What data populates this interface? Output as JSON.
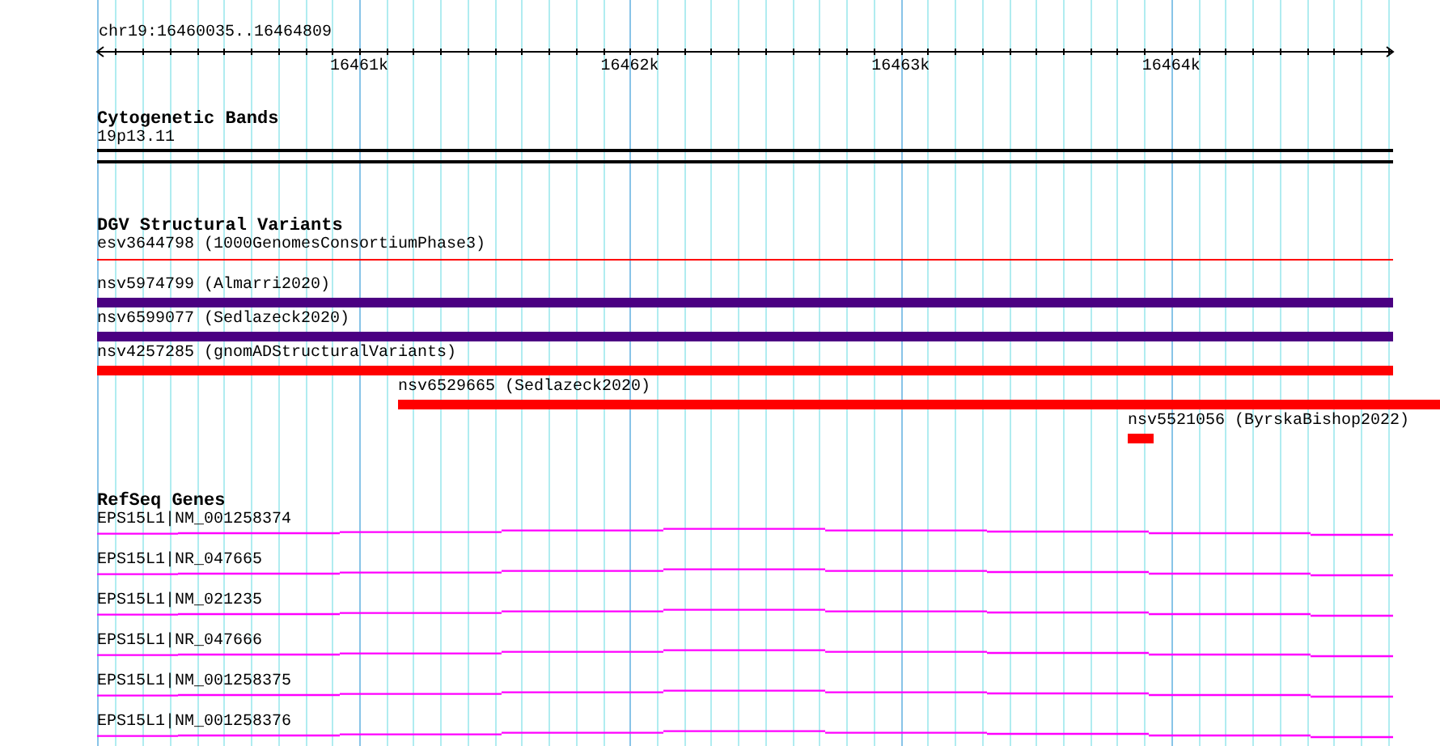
{
  "ruler": {
    "range": "chr19:16460035..16464809",
    "ticks": [
      "16461k",
      "16462k",
      "16463k",
      "16464k"
    ]
  },
  "tracks": [
    {
      "kind": "band",
      "title": "Cytogenetic Bands",
      "features": [
        {
          "label": "19p13.11"
        }
      ]
    },
    {
      "kind": "variants",
      "title": "DGV Structural Variants",
      "features": [
        {
          "label": "esv3644798 (1000GenomesConsortiumPhase3)",
          "kind": "line",
          "color": "#ff0000"
        },
        {
          "label": "nsv5974799 (Almarri2020)",
          "kind": "full",
          "color": "#4b0082"
        },
        {
          "label": "nsv6599077 (Sedlazeck2020)",
          "kind": "full",
          "color": "#4b0082"
        },
        {
          "label": "nsv4257285 (gnomADStructuralVariants)",
          "kind": "full",
          "color": "#ff0000"
        },
        {
          "label": "nsv6529665 (Sedlazeck2020)",
          "kind": "right",
          "color": "#ff0000"
        },
        {
          "label": "nsv5521056 (ByrskaBishop2022)",
          "kind": "short",
          "color": "#ff0000"
        }
      ]
    },
    {
      "kind": "genes",
      "title": "RefSeq Genes",
      "features": [
        {
          "label": "EPS15L1|NM_001258374"
        },
        {
          "label": "EPS15L1|NR_047665"
        },
        {
          "label": "EPS15L1|NM_021235"
        },
        {
          "label": "EPS15L1|NR_047666"
        },
        {
          "label": "EPS15L1|NM_001258375"
        },
        {
          "label": "EPS15L1|NM_001258376"
        }
      ]
    }
  ]
}
